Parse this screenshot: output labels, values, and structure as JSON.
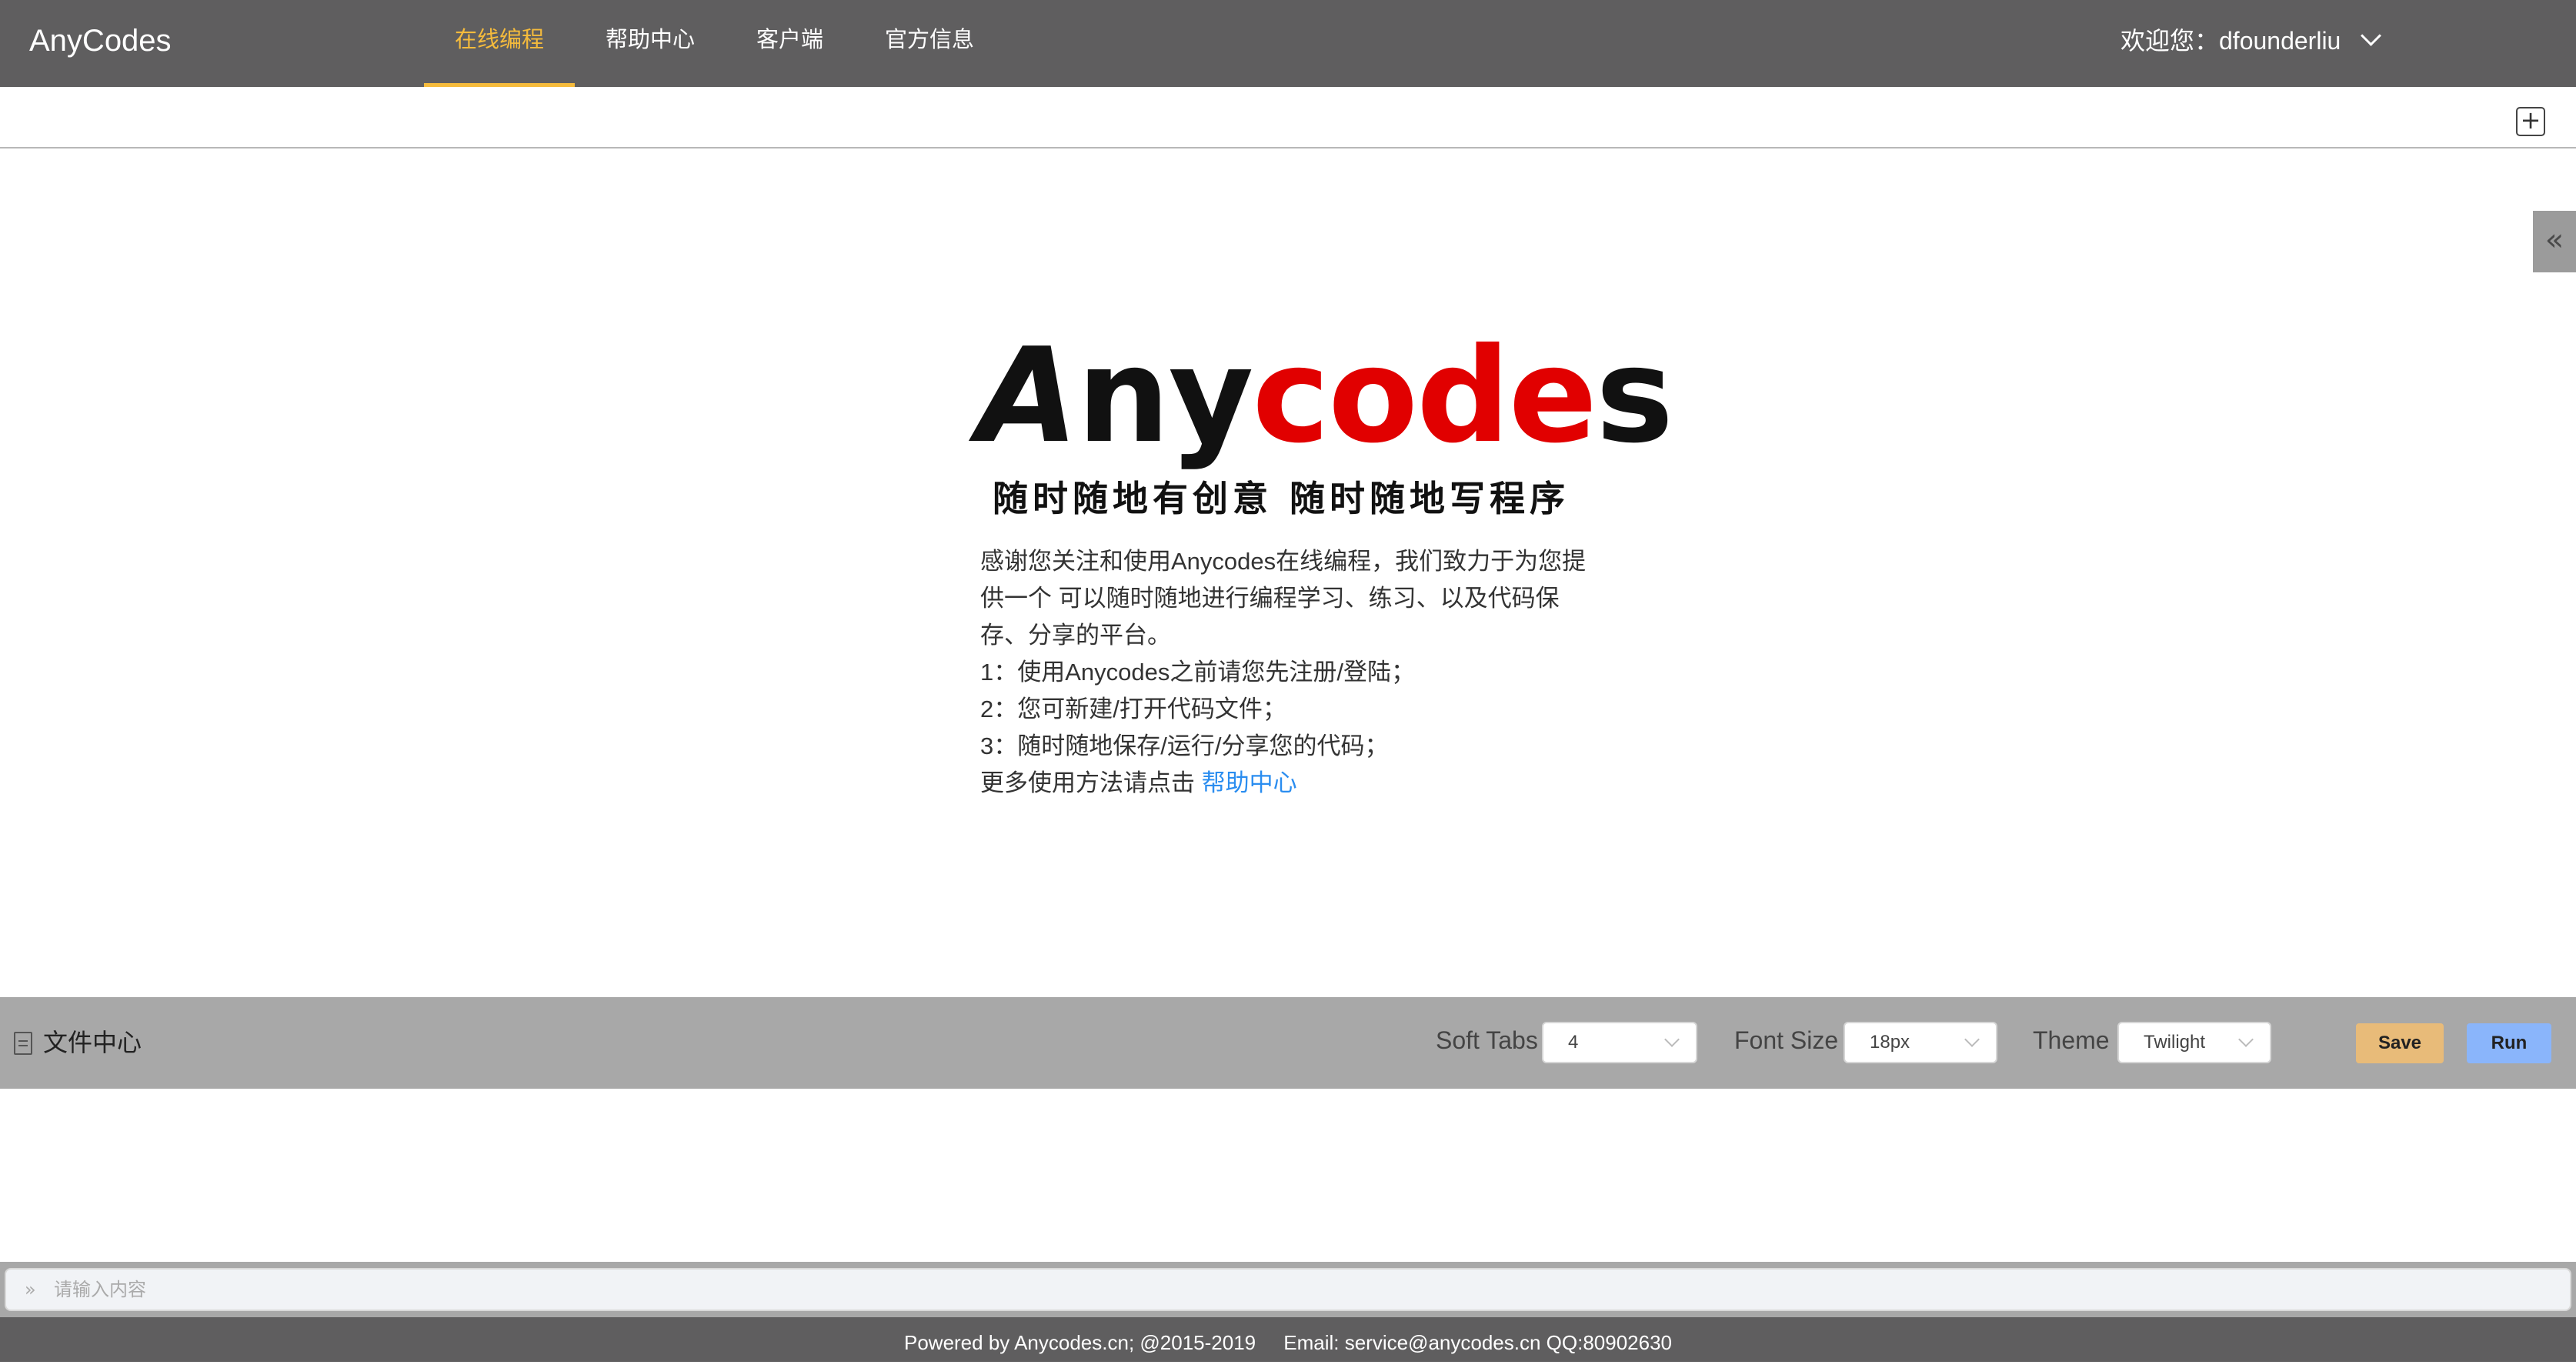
{
  "header": {
    "brand": "AnyCodes",
    "nav": [
      {
        "label": "在线编程",
        "active": true
      },
      {
        "label": "帮助中心",
        "active": false
      },
      {
        "label": "客户端",
        "active": false
      },
      {
        "label": "官方信息",
        "active": false
      }
    ],
    "user_greeting": "欢迎您：dfounderliu"
  },
  "tabs": {
    "add_icon": "plus-icon",
    "add_glyph": "+"
  },
  "side_toggle": {
    "icon": "double-chevron-left-icon",
    "glyph": "«"
  },
  "welcome": {
    "logo": {
      "part_a": "A",
      "part_ny": "ny",
      "part_code": "code",
      "part_s": "s"
    },
    "slogan": "随时随地有创意 随时随地写程序",
    "paragraph": "感谢您关注和使用Anycodes在线编程，我们致力于为您提供一个 可以随时随地进行编程学习、练习、以及代码保存、分享的平台。",
    "steps": [
      "1：使用Anycodes之前请您先注册/登陆；",
      "2：您可新建/打开代码文件；",
      "3：随时随地保存/运行/分享您的代码；"
    ],
    "more_prefix": "更多使用方法请点击 ",
    "help_link": "帮助中心"
  },
  "toolbar": {
    "files_label": "文件中心",
    "soft_tabs_label": "Soft Tabs",
    "soft_tabs_value": "4",
    "font_size_label": "Font Size",
    "font_size_value": "18px",
    "theme_label": "Theme",
    "theme_value": "Twilight",
    "save_label": "Save",
    "run_label": "Run"
  },
  "console": {
    "prompt_glyph": "»",
    "placeholder": "请输入内容"
  },
  "footer": {
    "text": "Powered by Anycodes.cn; @2015-2019     Email: service@anycodes.cn QQ:80902630"
  },
  "colors": {
    "topbar": "#5f5e5f",
    "active_nav": "#f5bb3c",
    "logo_red": "#e10000",
    "toolbar": "#a8a8a8",
    "save": "#e8bb79",
    "run": "#8ab5fb",
    "link": "#2a8df0"
  }
}
